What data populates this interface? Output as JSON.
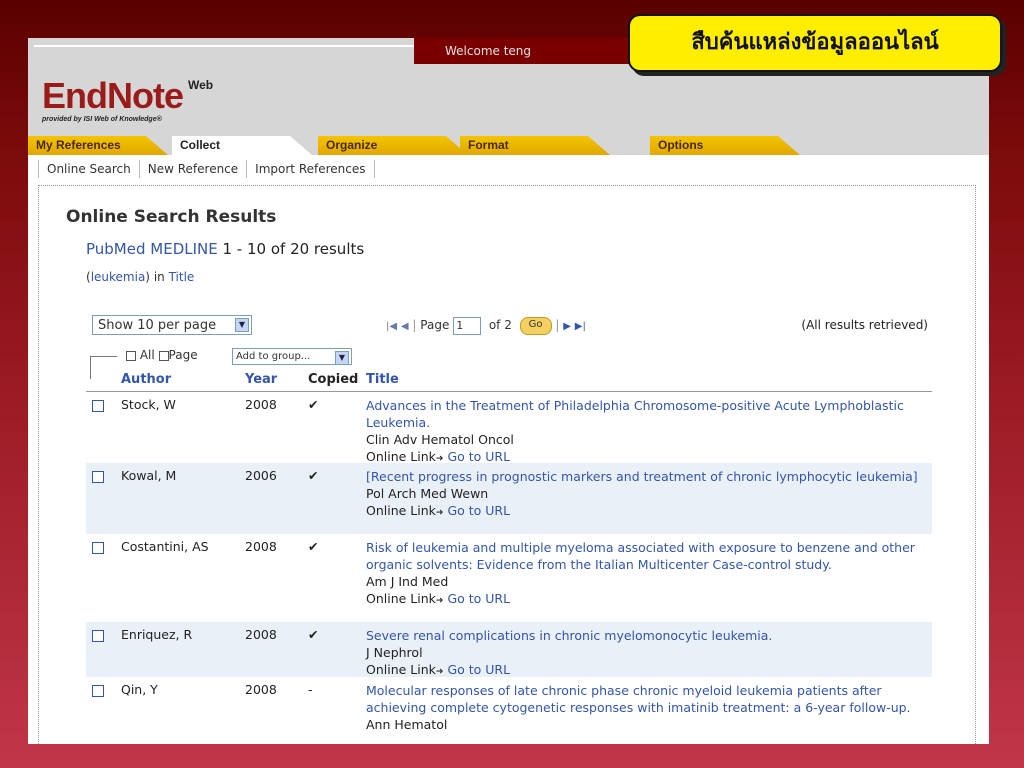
{
  "slide_title": "สืบค้นแหล่งข้อมูลออนไลน์",
  "welcome": "Welcome teng",
  "logo": {
    "main": "EndNote",
    "web": "Web",
    "sub": "provided by ISI Web of Knowledge®"
  },
  "tabs": [
    "My References",
    "Collect",
    "Organize",
    "Format",
    "Options"
  ],
  "active_tab": "Collect",
  "subnav": [
    "Online Search",
    "New Reference",
    "Import References"
  ],
  "results": {
    "heading": "Online Search Results",
    "source": "PubMed MEDLINE",
    "range": "1 - 10 of 20 results",
    "query_paren_open": "(",
    "query_term": "leukemia",
    "query_paren_close": ")",
    "query_in": "in",
    "query_field": "Title"
  },
  "controls": {
    "per_page": "Show 10 per page",
    "page_label": "Page",
    "page_value": "1",
    "of_label": "of",
    "total_pages": "2",
    "go_label": "Go",
    "all_retrieved": "(All results retrieved)",
    "all_label": "All",
    "page_cb_label": "Page",
    "add_to_group": "Add to group..."
  },
  "columns": {
    "author": "Author",
    "year": "Year",
    "copied": "Copied",
    "title": "Title"
  },
  "rows": [
    {
      "author": "Stock, W",
      "year": "2008",
      "copied": "✔",
      "title": "Advances in the Treatment of Philadelphia Chromosome-positive Acute Lymphoblastic Leukemia.",
      "journal": "Clin Adv Hematol Oncol",
      "link_label": "Online Link",
      "link_text": "Go to URL"
    },
    {
      "author": "Kowal, M",
      "year": "2006",
      "copied": "✔",
      "title": "[Recent progress in prognostic markers and treatment of chronic lymphocytic leukemia]",
      "journal": "Pol Arch Med Wewn",
      "link_label": "Online Link",
      "link_text": "Go to URL"
    },
    {
      "author": "Costantini, AS",
      "year": "2008",
      "copied": "✔",
      "title": "Risk of leukemia and multiple myeloma associated with exposure to benzene and other organic solvents: Evidence from the Italian Multicenter Case-control study.",
      "journal": "Am J Ind Med",
      "link_label": "Online Link",
      "link_text": "Go to URL"
    },
    {
      "author": "Enriquez, R",
      "year": "2008",
      "copied": "✔",
      "title": "Severe renal complications in chronic myelomonocytic leukemia.",
      "journal": "J Nephrol",
      "link_label": "Online Link",
      "link_text": "Go to URL"
    },
    {
      "author": "Qin, Y",
      "year": "2008",
      "copied": "-",
      "title": "Molecular responses of late chronic phase chronic myeloid leukemia patients after achieving complete cytogenetic responses with imatinib treatment: a 6-year follow-up.",
      "journal": "Ann Hematol",
      "link_label": "",
      "link_text": ""
    }
  ],
  "colors": {
    "accent_blue": "#3355aa",
    "brand_red": "#9b1b1b",
    "tab_yellow": "#f4c400",
    "slide_red": "#7a0000"
  }
}
